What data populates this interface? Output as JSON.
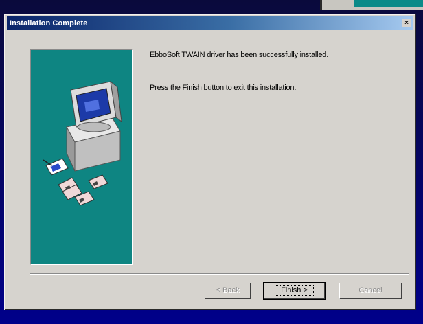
{
  "dialog": {
    "title": "Installation Complete",
    "close_label": "×"
  },
  "messages": {
    "line1": "EbboSoft TWAIN driver has been successfully installed.",
    "line2": "Press the Finish button to exit this installation."
  },
  "buttons": {
    "back_label": "< Back",
    "finish_label": "Finish >",
    "cancel_label": "Cancel"
  },
  "colors": {
    "title_gradient_start": "#0a246a",
    "side_panel": "#0e8582",
    "desktop": "#00008a"
  },
  "icons": [
    "computer-icon",
    "floppy-disk-icon",
    "close-icon"
  ]
}
